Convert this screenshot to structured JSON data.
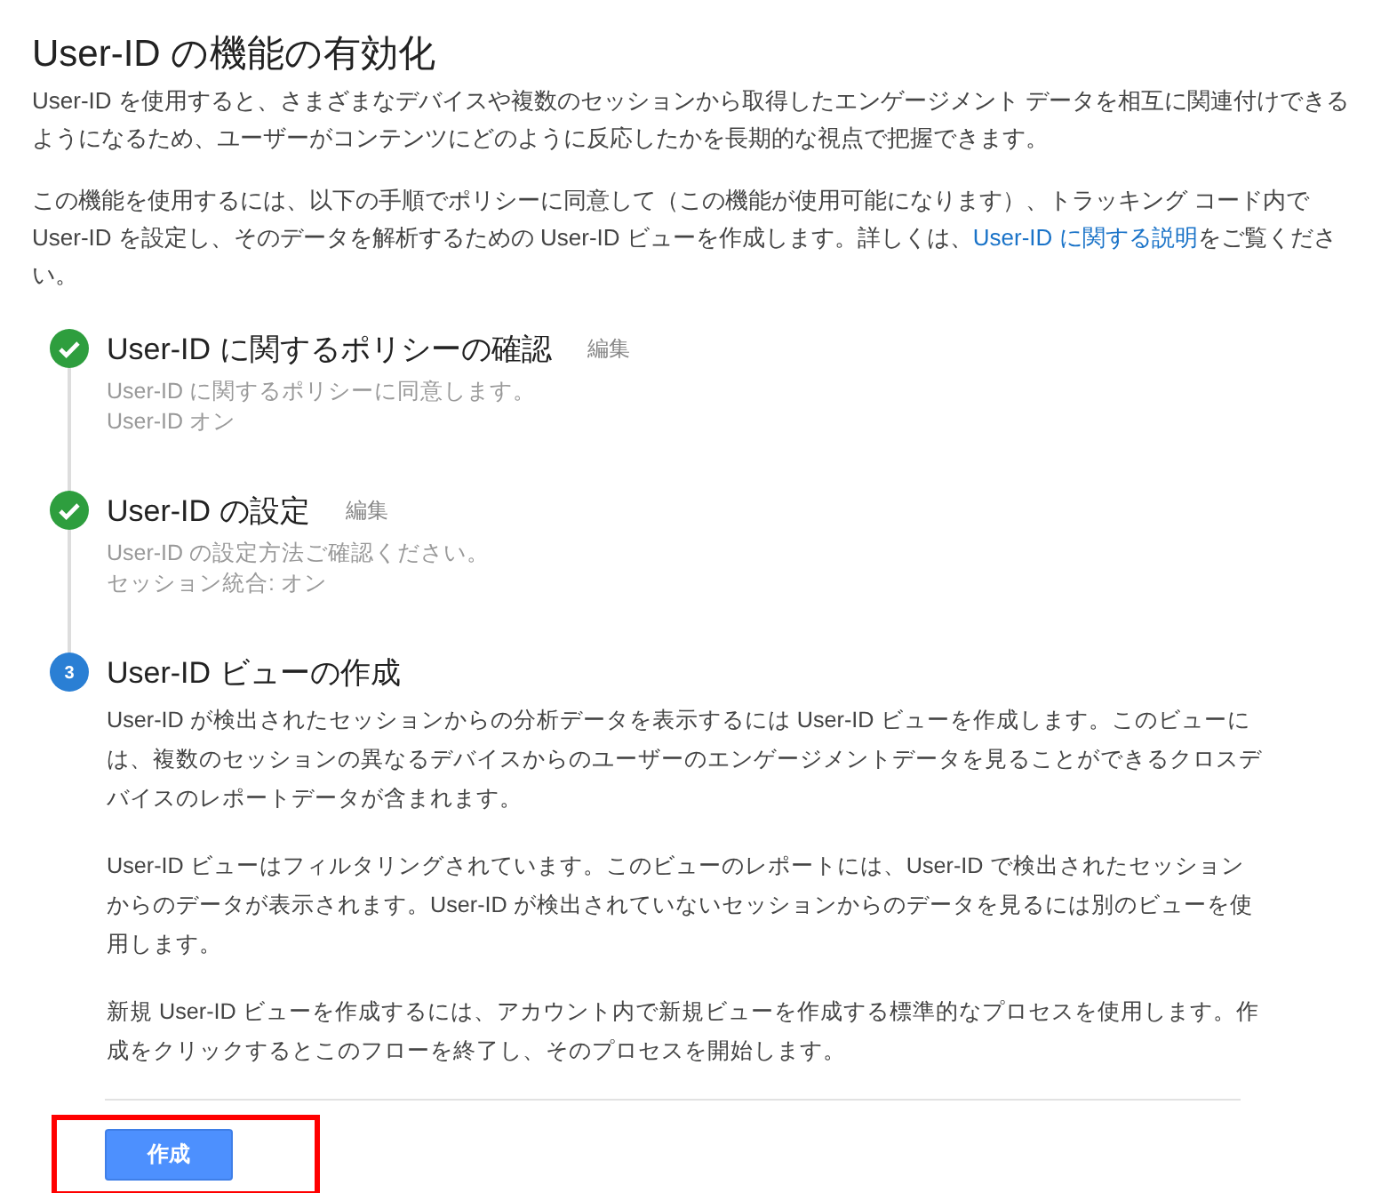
{
  "title": "User-ID の機能の有効化",
  "intro": "User-ID を使用すると、さまざまなデバイスや複数のセッションから取得したエンゲージメント データを相互に関連付けできるようになるため、ユーザーがコンテンツにどのように反応したかを長期的な視点で把握できます。",
  "instructions": {
    "before": "この機能を使用するには、以下の手順でポリシーに同意して（この機能が使用可能になります）、トラッキング コード内で User-ID を設定し、そのデータを解析するための User-ID ビューを作成します。詳しくは、",
    "link": "User-ID に関する説明",
    "after": "をご覧ください。"
  },
  "steps": [
    {
      "done": true,
      "title": "User-ID に関するポリシーの確認",
      "edit": "編集",
      "details": [
        "User-ID に関するポリシーに同意します。",
        "User-ID オン"
      ]
    },
    {
      "done": true,
      "title": "User-ID の設定",
      "edit": "編集",
      "details": [
        "User-ID の設定方法ご確認ください。",
        "セッション統合: オン"
      ]
    },
    {
      "done": false,
      "number": "3",
      "title": "User-ID ビューの作成",
      "details": [
        "User-ID が検出されたセッションからの分析データを表示するには User-ID ビューを作成します。このビューには、複数のセッションの異なるデバイスからのユーザーのエンゲージメントデータを見ることができるクロスデバイスのレポートデータが含まれます。",
        "User-ID ビューはフィルタリングされています。このビューのレポートには、User-ID で検出されたセッションからのデータが表示されます。User-ID が検出されていないセッションからのデータを見るには別のビューを使用します。",
        "新規 User-ID ビューを作成するには、アカウント内で新規ビューを作成する標準的なプロセスを使用します。作成をクリックするとこのフローを終了し、そのプロセスを開始します。"
      ]
    }
  ],
  "button": {
    "label": "作成",
    "highlighted": true
  }
}
